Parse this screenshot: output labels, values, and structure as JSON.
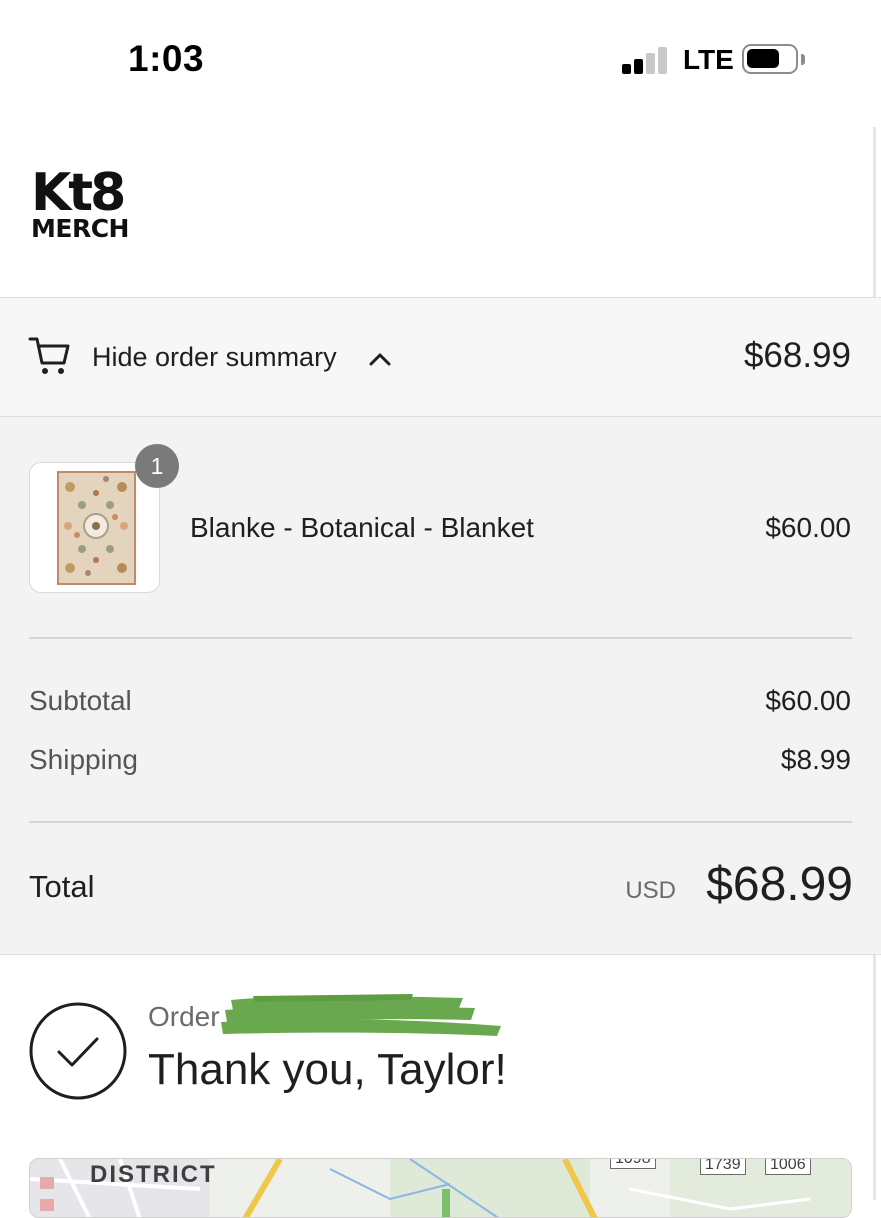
{
  "status_bar": {
    "time": "1:03",
    "network": "LTE",
    "signal_bars_active": 2,
    "signal_bars_total": 4,
    "battery_icon": "battery-icon"
  },
  "brand": {
    "logo_text_top": "Kt8",
    "logo_text_bottom": "MERCH"
  },
  "order_summary_toggle": {
    "label": "Hide order summary",
    "total": "$68.99",
    "icons": [
      "cart-icon",
      "chevron-up-icon"
    ]
  },
  "line_items": [
    {
      "quantity": "1",
      "name": "Blanke - Botanical - Blanket",
      "price": "$60.00"
    }
  ],
  "totals": {
    "subtotal_label": "Subtotal",
    "subtotal_value": "$60.00",
    "shipping_label": "Shipping",
    "shipping_value": "$8.99",
    "total_label": "Total",
    "currency": "USD",
    "total_value": "$68.99"
  },
  "confirmation": {
    "order_label": "Order #",
    "thank_you": "Thank you, Taylor!",
    "icon": "check-circle-icon"
  },
  "map": {
    "district_label": "DISTRICT",
    "road_numbers": [
      "1098",
      "1739",
      "1006"
    ]
  },
  "colors": {
    "panel_background": "#f3f3f3",
    "badge": "#7a7a7a",
    "text": "#1f1f1f",
    "muted_text": "#6b6b6b",
    "redaction_green": "#6aa84f"
  }
}
